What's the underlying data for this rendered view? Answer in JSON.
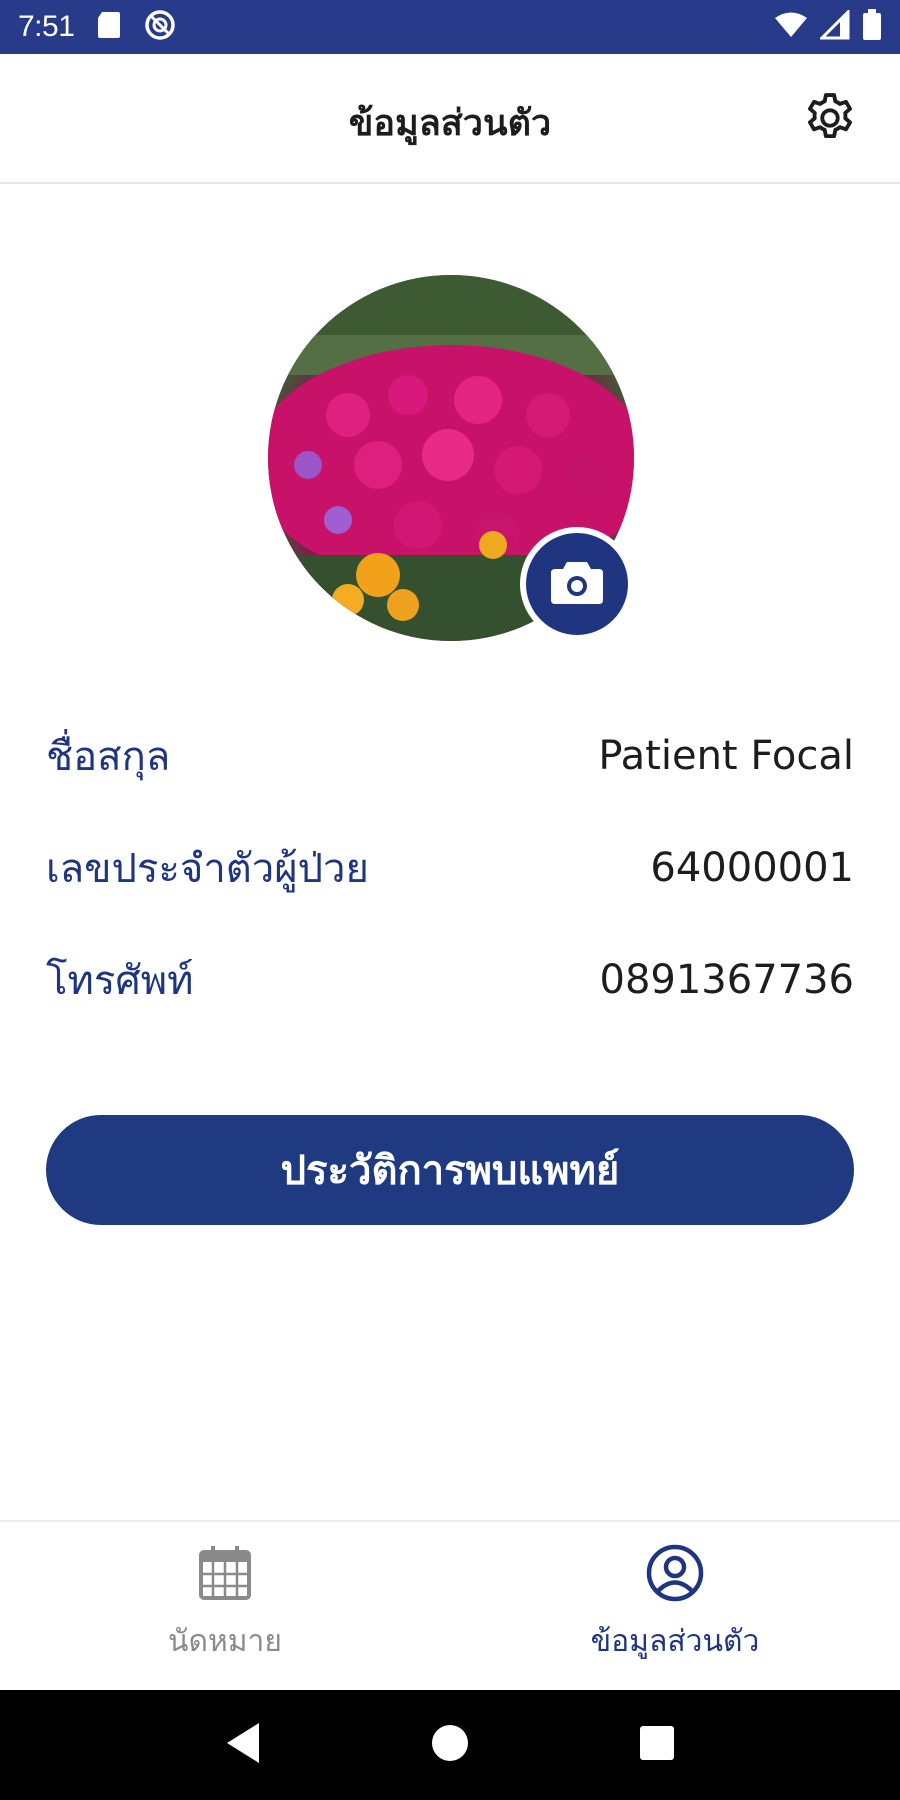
{
  "status_bar": {
    "time": "7:51",
    "icons": [
      "sd-card-icon",
      "do-not-disturb-icon",
      "wifi-icon",
      "signal-icon",
      "battery-icon"
    ]
  },
  "app_bar": {
    "title": "ข้อมูลส่วนตัว",
    "settings_icon": "gear-icon"
  },
  "profile": {
    "camera_icon": "camera-icon",
    "fields": [
      {
        "label": "ชื่อสกุล",
        "value": "Patient Focal"
      },
      {
        "label": "เลขประจำตัวผู้ป่วย",
        "value": "64000001"
      },
      {
        "label": "โทรศัพท์",
        "value": "0891367736"
      }
    ]
  },
  "history_button": {
    "label": "ประวัติการพบแพทย์"
  },
  "bottom_nav": {
    "items": [
      {
        "label": "นัดหมาย",
        "icon": "calendar-icon",
        "active": false
      },
      {
        "label": "ข้อมูลส่วนตัว",
        "icon": "account-icon",
        "active": true
      }
    ]
  },
  "colors": {
    "primary": "#1f3580",
    "status_bar": "#283a8a",
    "inactive": "#8a8a8a"
  }
}
